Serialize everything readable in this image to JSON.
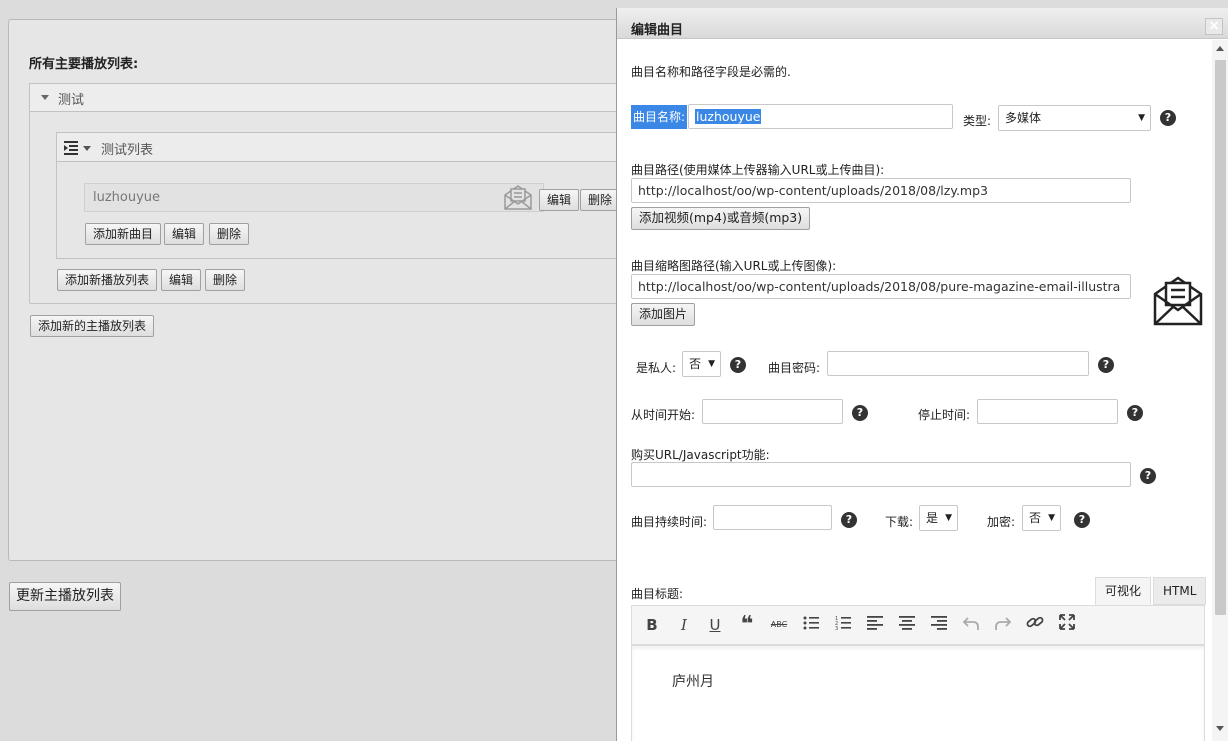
{
  "background": {
    "playlists_title": "所有主要播放列表:",
    "outer_playlist_name": "测试",
    "inner_playlist_name": "测试列表",
    "track_name": "luzhouyue",
    "track_edit": "编辑",
    "track_delete": "删除",
    "add_track": "添加新曲目",
    "inner_edit": "编辑",
    "inner_delete": "删除",
    "add_playlist": "添加新播放列表",
    "outer_edit": "编辑",
    "outer_delete": "删除",
    "add_main_playlist": "添加新的主播放列表",
    "update_main": "更新主播放列表"
  },
  "modal": {
    "title": "编辑曲目",
    "close": "×",
    "required_note": "曲目名称和路径字段是必需的.",
    "name_label": "曲目名称:",
    "name_value": "luzhouyue",
    "type_label": "类型:",
    "type_value": "多媒体",
    "path_label": "曲目路径(使用媒体上传器输入URL或上传曲目):",
    "path_value": "http://localhost/oo/wp-content/uploads/2018/08/lzy.mp3",
    "add_media_btn": "添加视频(mp4)或音频(mp3)",
    "thumb_label": "曲目缩略图路径(输入URL或上传图像):",
    "thumb_value": "http://localhost/oo/wp-content/uploads/2018/08/pure-magazine-email-illustra",
    "add_image_btn": "添加图片",
    "private_label": "是私人:",
    "private_value": "否",
    "password_label": "曲目密码:",
    "password_value": "",
    "start_label": "从时间开始:",
    "start_value": "",
    "stop_label": "停止时间:",
    "stop_value": "",
    "buy_label": "购买URL/Javascript功能:",
    "buy_value": "",
    "duration_label": "曲目持续时间:",
    "duration_value": "",
    "download_label": "下载:",
    "download_value": "是",
    "encrypt_label": "加密:",
    "encrypt_value": "否",
    "help": "?",
    "caption_label": "曲目标题:",
    "tab_visual": "可视化",
    "tab_html": "HTML",
    "toolbar": {
      "bold": "B",
      "italic": "I",
      "underline": "U",
      "quote": "❝",
      "strike": "ABC"
    },
    "editor_content": "庐州月",
    "select_arrow": "▼"
  },
  "icons": [
    "envelope-icon",
    "list-menu-icon",
    "bold-icon",
    "italic-icon",
    "underline-icon",
    "blockquote-icon",
    "strikethrough-icon",
    "bullet-list-icon",
    "numbered-list-icon",
    "align-left-icon",
    "align-center-icon",
    "align-right-icon",
    "undo-icon",
    "redo-icon",
    "link-icon",
    "fullscreen-icon"
  ]
}
